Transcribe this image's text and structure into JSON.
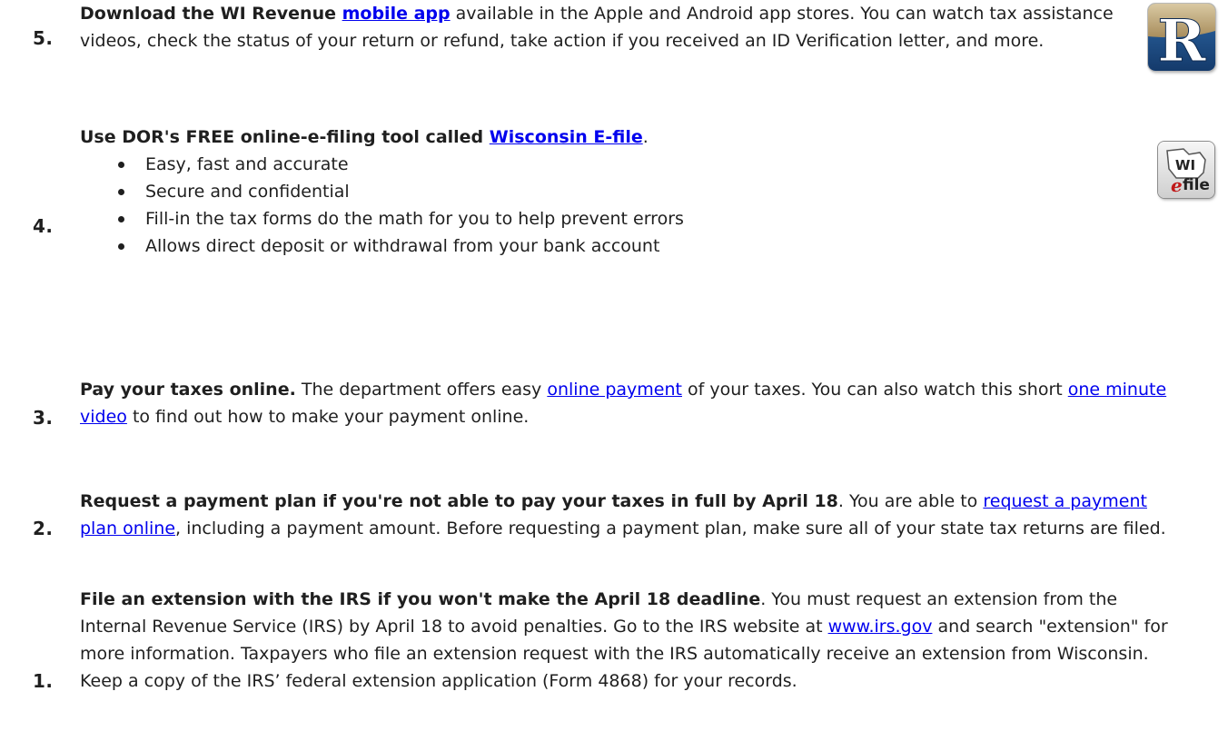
{
  "items": [
    {
      "number": "5.",
      "lead_bold": "Download the WI Revenue ",
      "link": "mobile app",
      "rest": " available in the Apple and Android app stores.  You can watch tax assistance videos, check the status of your return or refund, take action if you received an ID Verification letter, and more."
    },
    {
      "number": "4.",
      "lead_bold": "Use DOR's FREE online-e-filing tool called ",
      "link": "Wisconsin E-file",
      "after_link": ".",
      "bullets": [
        "Easy, fast and accurate",
        "Secure and confidential",
        "Fill-in the tax forms do the math for you to help prevent errors",
        "Allows direct deposit or withdrawal from your bank account"
      ]
    },
    {
      "number": "3.",
      "lead_bold": "Pay your taxes online.",
      "text1": "  The department offers easy ",
      "link1": "online payment",
      "text2": " of your taxes.  You can also watch this short ",
      "link2": "one minute video",
      "text3": " to find out how to make your payment online."
    },
    {
      "number": "2.",
      "lead_bold": "Request a payment plan if you're not able to pay your taxes in full by April 18",
      "text1": ".  You are able to ",
      "link": "request a payment plan online",
      "text2": ", including a payment amount.  Before requesting a payment plan, make sure all of your state tax returns are filed."
    },
    {
      "number": "1.",
      "lead_bold": "File an extension with the IRS if you won't make the April 18 deadline",
      "text1": ".  You must request an extension from the Internal Revenue Service (IRS) by April 18 to avoid penalties.  Go to the IRS website at ",
      "link": "www.irs.gov",
      "text2": " and search \"extension\" for more information.  Taxpayers who file an extension request with the IRS automatically receive an extension from Wisconsin.  Keep a copy of the IRS’ federal extension application (Form 4868) for your records."
    }
  ],
  "icons": {
    "app_icon": {
      "letter": "R",
      "name": "wi-revenue-app-icon"
    },
    "efile_icon": {
      "line1": "WI",
      "line2": "file",
      "name": "wi-efile-icon"
    }
  },
  "colors": {
    "link": "#0000ee",
    "text": "#1f1f1f",
    "app_icon_blue": "#1e4f8a",
    "app_icon_tan": "#b59a6a"
  }
}
